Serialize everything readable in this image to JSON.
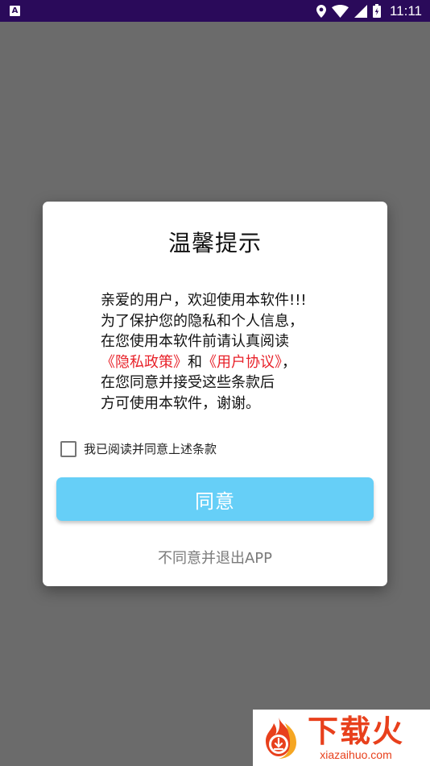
{
  "status_bar": {
    "notification_icon": "A",
    "time": "11:11",
    "icons": [
      "location-icon",
      "wifi-icon",
      "signal-icon",
      "battery-icon"
    ]
  },
  "dialog": {
    "title": "温馨提示",
    "body": {
      "line1": "亲爱的用户，欢迎使用本软件!!!",
      "line2": "为了保护您的隐私和个人信息，",
      "line3": "在您使用本软件前请认真阅读",
      "privacy_link": "《隐私政策》",
      "and": "和",
      "user_agreement_link": "《用户协议》",
      "comma": "，",
      "line5": "在您同意并接受这些条款后",
      "line6": "方可使用本软件，谢谢。"
    },
    "checkbox_label": "我已阅读并同意上述条款",
    "checkbox_checked": false,
    "agree_button": "同意",
    "exit_link": "不同意并退出APP"
  },
  "colors": {
    "status_bar": "#2a0a5a",
    "overlay": "#6b6b6b",
    "agree_button": "#66cff7",
    "link": "#e8222a"
  },
  "watermark": {
    "cn": "下载火",
    "url": "xiazaihuo.com"
  }
}
